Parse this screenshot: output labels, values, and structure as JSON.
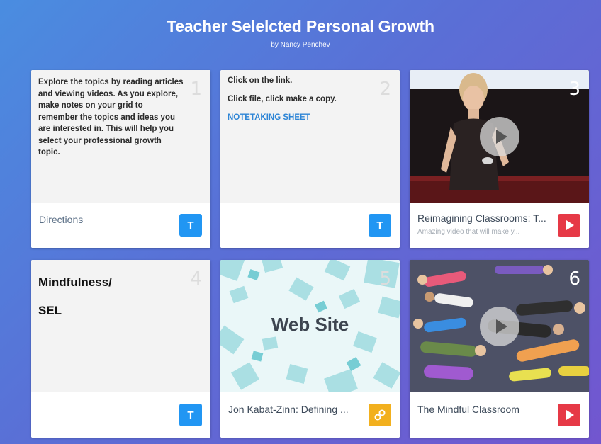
{
  "header": {
    "title": "Teacher Selelcted Personal Growth",
    "subtitle": "by Nancy Penchev"
  },
  "tiles": [
    {
      "number": "1",
      "text": "Explore the topics by reading articles and viewing videos. As you explore, make notes on your grid to remember the topics and ideas you are interested in. This will help you select your professional growth topic.",
      "footer_title": "Directions",
      "badge": "T",
      "badge_icon": "text-icon"
    },
    {
      "number": "2",
      "line1": "Click on the link.",
      "line2": "Click file, click make a copy.",
      "link": "NOTETAKING SHEET",
      "footer_title": "",
      "badge": "T",
      "badge_icon": "text-icon"
    },
    {
      "number": "3",
      "footer_title": "Reimagining Classrooms: T...",
      "footer_sub": "Amazing video that will make y...",
      "badge_icon": "youtube-icon"
    },
    {
      "number": "4",
      "line1": "Mindfulness/",
      "line2": "SEL",
      "footer_title": "",
      "badge": "T",
      "badge_icon": "text-icon"
    },
    {
      "number": "5",
      "image_label": "Web Site",
      "footer_title": "Jon Kabat-Zinn: Defining ...",
      "badge_icon": "link-icon"
    },
    {
      "number": "6",
      "footer_title": "The Mindful Classroom",
      "badge_icon": "youtube-icon"
    }
  ],
  "colors": {
    "background_start": "#4a8de0",
    "background_end": "#7256cf",
    "text_badge": "#2196f3",
    "youtube_badge": "#e63946",
    "link_badge": "#f2b01e",
    "link_text": "#2f86d6"
  }
}
